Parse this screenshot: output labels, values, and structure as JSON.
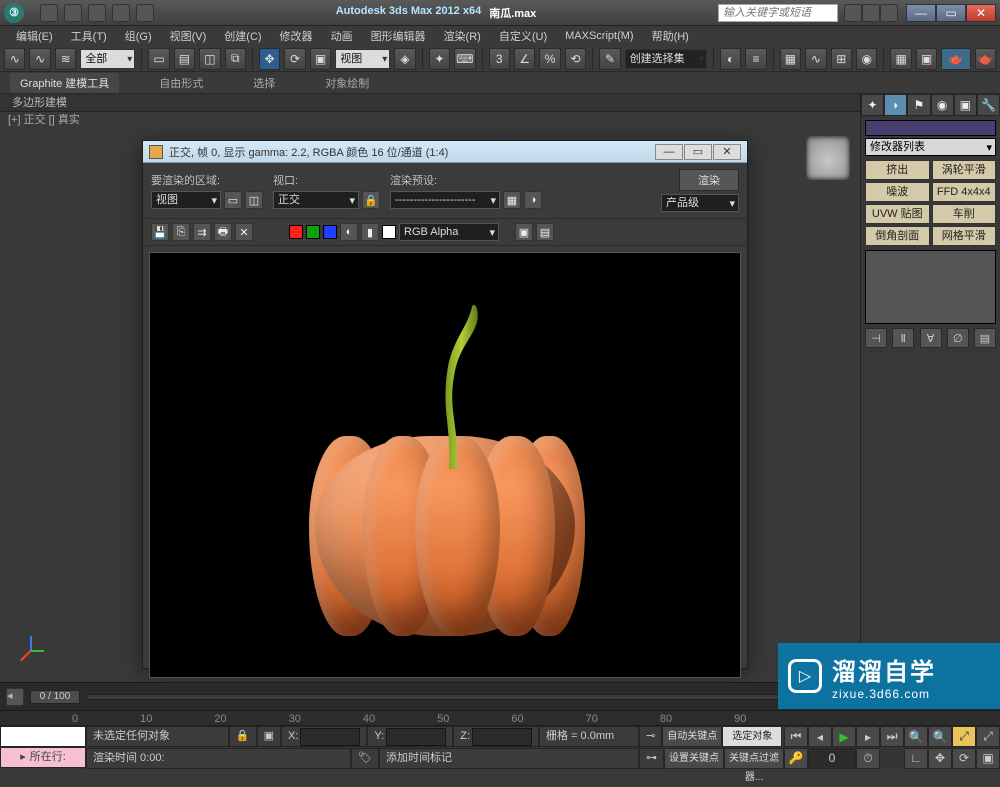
{
  "title": {
    "app": "Autodesk 3ds Max  2012  x64",
    "file": "南瓜.max",
    "search_ph": "输入关键字或短语"
  },
  "menu": [
    "编辑(E)",
    "工具(T)",
    "组(G)",
    "视图(V)",
    "创建(C)",
    "修改器",
    "动画",
    "图形编辑器",
    "渲染(R)",
    "自定义(U)",
    "MAXScript(M)",
    "帮助(H)"
  ],
  "main_tb": {
    "scope": "全部",
    "viewbtn": "视图",
    "setname": "创建选择集"
  },
  "ribbon": {
    "tabs": [
      "Graphite 建模工具",
      "自由形式",
      "选择",
      "对象绘制"
    ],
    "sub": "多边形建模"
  },
  "viewport_label": "[+] 正交 [] 真实",
  "cmd": {
    "modlist": "修改器列表",
    "btns": [
      "挤出",
      "涡轮平滑",
      "噪波",
      "FFD 4x4x4",
      "UVW 贴图",
      "车削",
      "倒角剖面",
      "网格平滑"
    ]
  },
  "render": {
    "title": "正交, 帧 0, 显示 gamma: 2.2, RGBA 颜色 16 位/通道 (1:4)",
    "area_lbl": "要渲染的区域:",
    "area_dd": "视图",
    "vp_lbl": "视口:",
    "vp_dd": "正交",
    "preset_lbl": "渲染预设:",
    "preset_dd": "----------------------",
    "prod_dd": "产品级",
    "render_btn": "渲染",
    "alpha_dd": "RGB Alpha"
  },
  "timeline": {
    "slider": "0 / 100",
    "ticks": [
      "0",
      "10",
      "20",
      "30",
      "40",
      "50",
      "60",
      "70",
      "80",
      "90"
    ]
  },
  "status": {
    "row_btn": "所在行:",
    "noselect": "未选定任何对象",
    "rendertime": "渲染时间  0:00:",
    "addmark": "添加时间标记",
    "x": "X:",
    "y": "Y:",
    "z": "Z:",
    "grid": "栅格 = 0.0mm",
    "autokey": "自动关键点",
    "selset": "选定对象",
    "setkey": "设置关键点",
    "keyfilter": "关键点过滤器..."
  },
  "wm": {
    "big": "溜溜自学",
    "url": "zixue.3d66.com"
  }
}
